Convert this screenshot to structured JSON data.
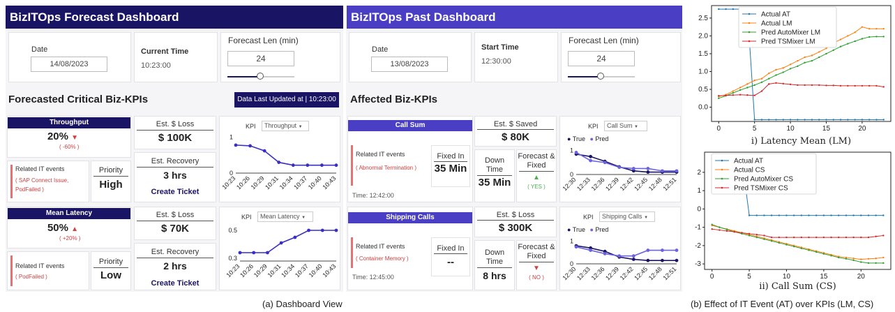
{
  "forecast": {
    "title": "BizITOps Forecast Dashboard",
    "date_label": "Date",
    "date_value": "14/08/2023",
    "time_label": "Current Time",
    "time_value": "10:23:00",
    "len_label": "Forecast Len (min)",
    "len_value": "24",
    "len_fraction": 0.5,
    "section": "Forecasted Critical Biz-KPIs",
    "updated": "Data Last Updated at | 10:23:00",
    "kpi1": {
      "name": "Throughput",
      "value": "20%",
      "arrow": "▼",
      "change": "( -60% )",
      "events_label": "Related IT events",
      "events": "( SAP Connect Issue, PodFailed )",
      "priority_label": "Priority",
      "priority": "High",
      "loss_label": "Est. $ Loss",
      "loss": "$ 100K",
      "recovery_label": "Est. Recovery",
      "recovery": "3 hrs",
      "ticket": "Create Ticket",
      "kpi_label": "KPI",
      "kpi_select": "Throughput"
    },
    "kpi2": {
      "name": "Mean Latency",
      "value": "50%",
      "arrow": "▲",
      "change": "( +20% )",
      "events_label": "Related IT events",
      "events": "( PodFailed )",
      "priority_label": "Priority",
      "priority": "Low",
      "loss_label": "Est. $ Loss",
      "loss": "$ 70K",
      "recovery_label": "Est. Recovery",
      "recovery": "2 hrs",
      "ticket": "Create Ticket",
      "kpi_label": "KPI",
      "kpi_select": "Mean Latency"
    }
  },
  "past": {
    "title": "BizITOps Past Dashboard",
    "date_label": "Date",
    "date_value": "13/08/2023",
    "time_label": "Start Time",
    "time_value": "12:30:00",
    "len_label": "Forecast Len (min)",
    "len_value": "24",
    "len_fraction": 0.5,
    "section": "Affected Biz-KPIs",
    "kpi1": {
      "name": "Call Sum",
      "saved_label": "Est. $ Saved",
      "saved": "$ 80K",
      "events_label": "Related IT events",
      "events": "( Abnormal Termination )",
      "time": "Time: 12:42:00",
      "fixed_label": "Fixed In",
      "fixed": "35 Min",
      "down_label": "Down Time",
      "down": "35 Min",
      "ff_label": "Forecast & Fixed",
      "ff_arrow": "▲",
      "ff": "( YES )",
      "kpi_label": "KPI",
      "kpi_select": "Call Sum",
      "legend_true": "True",
      "legend_pred": "Pred"
    },
    "kpi2": {
      "name": "Shipping Calls",
      "saved_label": "Est. $ Loss",
      "saved": "$ 300K",
      "events_label": "Related IT events",
      "events": "( Container Memory )",
      "time": "Time: 12:45:00",
      "fixed_label": "Fixed In",
      "fixed": "--",
      "down_label": "Down Time",
      "down": "8 hrs",
      "ff_label": "Forecast & Fixed",
      "ff_arrow": "▼",
      "ff": "( NO )",
      "kpi_label": "KPI",
      "kpi_select": "Shipping Calls",
      "legend_true": "True",
      "legend_pred": "Pred"
    }
  },
  "captions": {
    "left": "(a)  Dashboard View",
    "right": "(b) Effect of IT Event (AT) over KPIs (LM, CS)"
  },
  "chart_data": [
    {
      "type": "line",
      "id": "throughput",
      "categories": [
        "10:23",
        "10:26",
        "10:29",
        "10:31",
        "10:34",
        "10:37",
        "10:40",
        "10:43"
      ],
      "series": [
        {
          "values": [
            0.78,
            0.76,
            0.62,
            0.3,
            0.22,
            0.22,
            0.22,
            0.22
          ]
        }
      ],
      "ylim": [
        0,
        1.05
      ],
      "yticks": [
        0,
        1
      ],
      "color": "#3a2fc4"
    },
    {
      "type": "line",
      "id": "latency",
      "categories": [
        "10:23",
        "10:26",
        "10:29",
        "10:31",
        "10:34",
        "10:37",
        "10:40",
        "10:43"
      ],
      "series": [
        {
          "values": [
            0.34,
            0.34,
            0.34,
            0.41,
            0.45,
            0.5,
            0.5,
            0.5
          ]
        }
      ],
      "ylim": [
        0.28,
        0.53
      ],
      "yticks": [
        0.3,
        0.5
      ],
      "color": "#3a2fc4"
    },
    {
      "type": "line",
      "id": "callsum",
      "categories": [
        "12:30",
        "12:33",
        "12:36",
        "12:39",
        "12:42",
        "12:45",
        "12:48",
        "12:51"
      ],
      "series": [
        {
          "name": "True",
          "values": [
            0.85,
            0.75,
            0.55,
            0.32,
            0.15,
            0.1,
            0.1,
            0.1
          ]
        },
        {
          "name": "Pred",
          "values": [
            0.92,
            0.58,
            0.5,
            0.3,
            0.25,
            0.25,
            0.15,
            0.15
          ]
        }
      ],
      "ylim": [
        0,
        1.05
      ],
      "yticks": [
        0,
        1
      ],
      "colors": [
        "#1a1464",
        "#6b62e0"
      ]
    },
    {
      "type": "line",
      "id": "shipping",
      "categories": [
        "12:30",
        "12:33",
        "12:36",
        "12:39",
        "12:42",
        "12:45",
        "12:48",
        "12:51"
      ],
      "series": [
        {
          "name": "True",
          "values": [
            0.8,
            0.7,
            0.55,
            0.3,
            0.2,
            0.15,
            0.15,
            0.15
          ]
        },
        {
          "name": "Pred",
          "values": [
            0.75,
            0.6,
            0.45,
            0.35,
            0.35,
            0.6,
            0.6,
            0.6
          ]
        }
      ],
      "ylim": [
        0,
        1.05
      ],
      "yticks": [
        0,
        1
      ],
      "colors": [
        "#1a1464",
        "#6b62e0"
      ]
    },
    {
      "type": "line",
      "id": "lm",
      "title": "i) Latency Mean (LM)",
      "x": [
        0,
        1,
        2,
        3,
        4,
        5,
        6,
        7,
        8,
        9,
        10,
        11,
        12,
        13,
        14,
        15,
        16,
        17,
        18,
        19,
        20,
        21,
        22,
        23
      ],
      "xticks": [
        0,
        5,
        10,
        15,
        20
      ],
      "yticks": [
        0.0,
        0.5,
        1.0,
        1.5,
        2.0,
        2.5
      ],
      "ylim": [
        -0.4,
        2.85
      ],
      "xlim": [
        -1,
        24
      ],
      "series": [
        {
          "name": "Actual AT",
          "color": "#1f77b4",
          "values": [
            2.75,
            2.75,
            2.75,
            2.75,
            2.75,
            -0.35,
            -0.35,
            -0.35,
            -0.35,
            -0.35,
            -0.35,
            -0.35,
            -0.35,
            -0.35,
            -0.35,
            -0.35,
            -0.35,
            -0.35,
            -0.35,
            -0.35,
            -0.35,
            -0.35,
            -0.35,
            -0.35
          ]
        },
        {
          "name": "Actual LM",
          "color": "#ff7f0e",
          "values": [
            0.3,
            0.35,
            0.45,
            0.55,
            0.65,
            0.75,
            0.8,
            0.95,
            1.05,
            1.1,
            1.2,
            1.3,
            1.4,
            1.45,
            1.55,
            1.65,
            1.8,
            1.9,
            2.0,
            2.1,
            2.25,
            2.2,
            2.2,
            2.2
          ]
        },
        {
          "name": "Pred AutoMixer LM",
          "color": "#2ca02c",
          "values": [
            0.25,
            0.32,
            0.4,
            0.48,
            0.55,
            0.62,
            0.7,
            0.8,
            0.9,
            0.98,
            1.08,
            1.15,
            1.25,
            1.3,
            1.4,
            1.5,
            1.6,
            1.7,
            1.78,
            1.85,
            1.92,
            1.97,
            1.98,
            1.98
          ]
        },
        {
          "name": "Pred TSMixer LM",
          "color": "#d62728",
          "values": [
            0.32,
            0.33,
            0.34,
            0.35,
            0.34,
            0.33,
            0.45,
            0.65,
            0.68,
            0.66,
            0.64,
            0.62,
            0.62,
            0.62,
            0.62,
            0.61,
            0.61,
            0.6,
            0.6,
            0.6,
            0.6,
            0.6,
            0.6,
            0.57
          ]
        }
      ]
    },
    {
      "type": "line",
      "id": "cs",
      "title": "ii) Call Sum (CS)",
      "x": [
        0,
        1,
        2,
        3,
        4,
        5,
        6,
        7,
        8,
        9,
        10,
        11,
        12,
        13,
        14,
        15,
        16,
        17,
        18,
        19,
        20,
        21,
        22,
        23
      ],
      "xticks": [
        0,
        5,
        10,
        15,
        20
      ],
      "yticks": [
        -3,
        -2,
        -1,
        0,
        1,
        2
      ],
      "ylim": [
        -3.3,
        3.1
      ],
      "xlim": [
        -1,
        24
      ],
      "series": [
        {
          "name": "Actual AT",
          "color": "#1f77b4",
          "values": [
            2.75,
            2.75,
            2.75,
            2.75,
            2.75,
            -0.35,
            -0.35,
            -0.35,
            -0.35,
            -0.35,
            -0.35,
            -0.35,
            -0.35,
            -0.35,
            -0.35,
            -0.35,
            -0.35,
            -0.35,
            -0.35,
            -0.35,
            -0.35,
            -0.35,
            -0.35,
            -0.35
          ]
        },
        {
          "name": "Actual CS",
          "color": "#ff7f0e",
          "values": [
            -0.9,
            -1.0,
            -1.1,
            -1.2,
            -1.3,
            -1.4,
            -1.5,
            -1.6,
            -1.7,
            -1.8,
            -1.9,
            -2.0,
            -2.1,
            -2.2,
            -2.3,
            -2.4,
            -2.5,
            -2.6,
            -2.65,
            -2.7,
            -2.75,
            -2.72,
            -2.7,
            -2.65
          ]
        },
        {
          "name": "Pred AutoMixer CS",
          "color": "#2ca02c",
          "values": [
            -0.85,
            -1.0,
            -1.12,
            -1.25,
            -1.35,
            -1.45,
            -1.55,
            -1.65,
            -1.75,
            -1.85,
            -1.95,
            -2.05,
            -2.15,
            -2.25,
            -2.35,
            -2.45,
            -2.55,
            -2.65,
            -2.72,
            -2.8,
            -2.9,
            -2.95,
            -2.95,
            -2.95
          ]
        },
        {
          "name": "Pred TSMixer CS",
          "color": "#d62728",
          "values": [
            -1.1,
            -1.15,
            -1.2,
            -1.25,
            -1.3,
            -1.35,
            -1.4,
            -1.45,
            -1.55,
            -1.55,
            -1.55,
            -1.55,
            -1.55,
            -1.55,
            -1.55,
            -1.55,
            -1.55,
            -1.55,
            -1.55,
            -1.55,
            -1.55,
            -1.55,
            -1.5,
            -1.45
          ]
        }
      ]
    }
  ]
}
